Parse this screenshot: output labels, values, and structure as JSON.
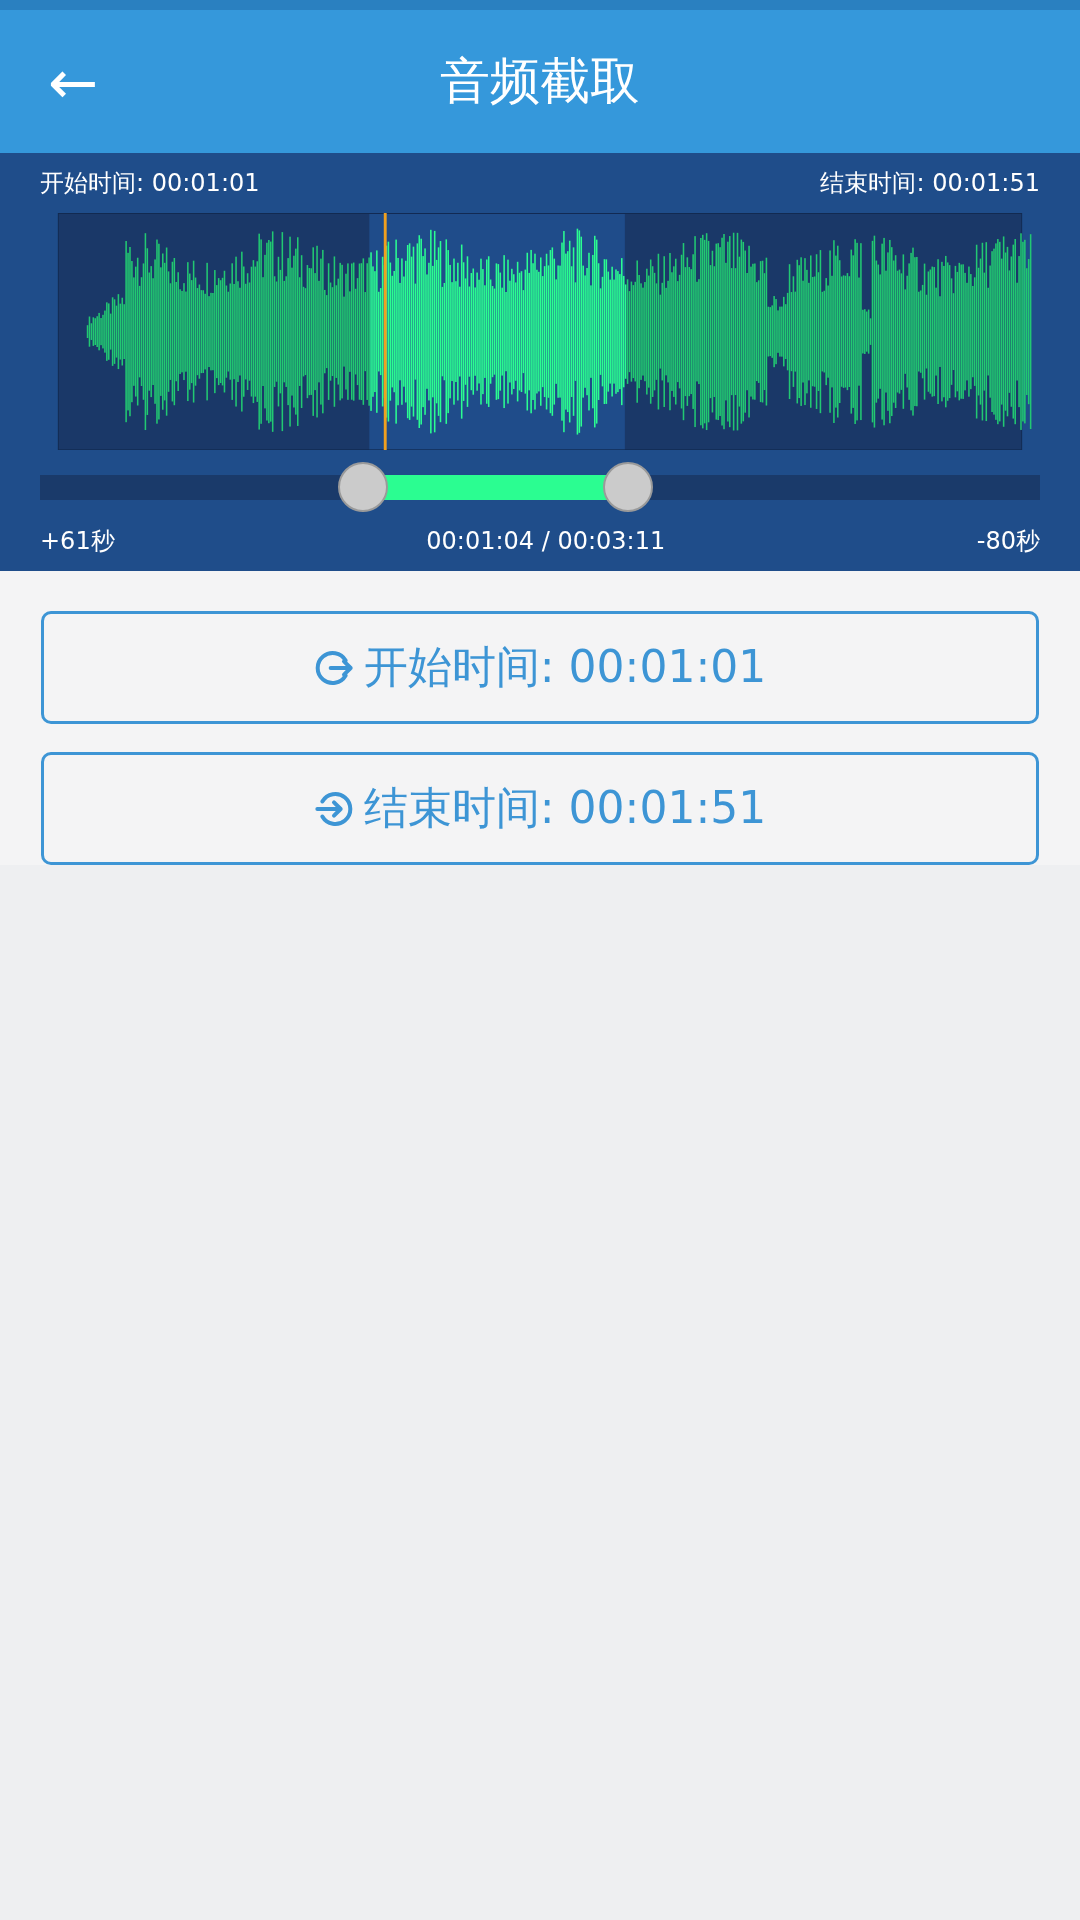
{
  "header": {
    "back_icon": "←",
    "title": "音频截取"
  },
  "editor": {
    "start_label": "开始时间: 00:01:01",
    "end_label": "结束时间: 00:01:51",
    "offset_start": "+61秒",
    "position": "00:01:04 / 00:03:11",
    "offset_end": "-80秒"
  },
  "buttons": [
    {
      "kind": "start",
      "label": "开始时间: 00:01:01"
    },
    {
      "kind": "end",
      "label": "结束时间: 00:01:51"
    }
  ]
}
